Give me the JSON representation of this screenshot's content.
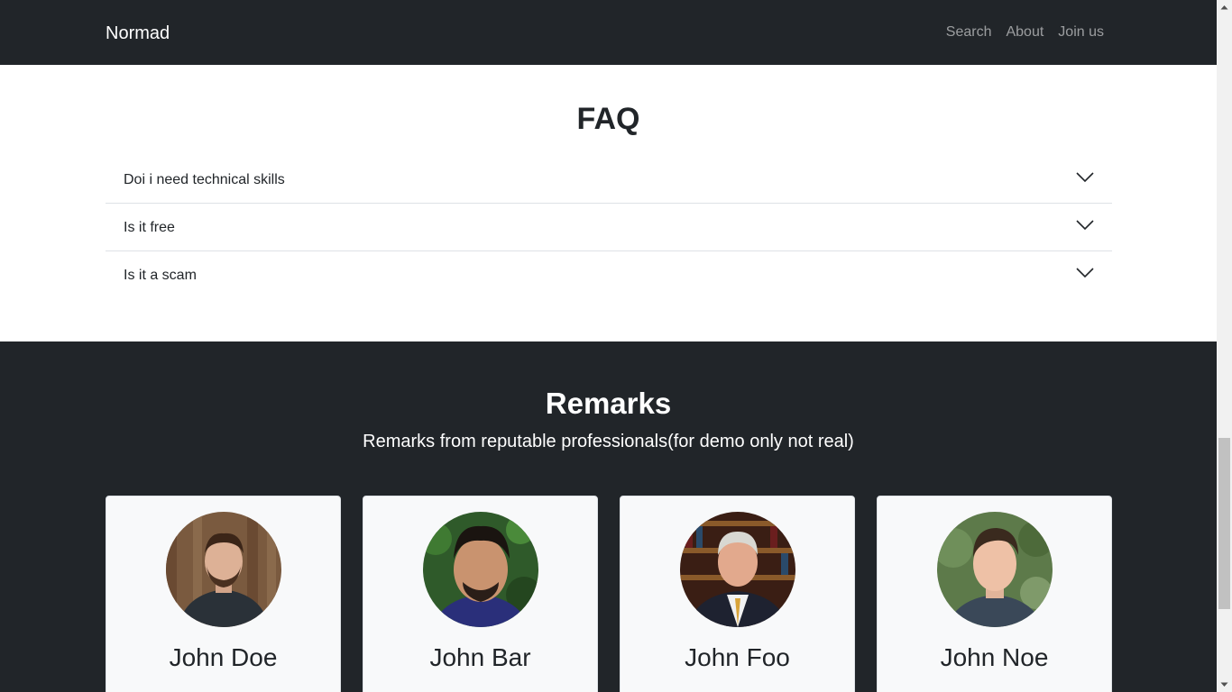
{
  "navbar": {
    "brand": "Normad",
    "links": [
      "Search",
      "About",
      "Join us"
    ]
  },
  "faq": {
    "title": "FAQ",
    "items": [
      {
        "question": "Doi i need technical skills"
      },
      {
        "question": "Is it free"
      },
      {
        "question": "Is it a scam"
      }
    ]
  },
  "remarks": {
    "title": "Remarks",
    "subtitle": "Remarks from reputable professionals(for demo only not real)",
    "cards": [
      {
        "name": "John Doe"
      },
      {
        "name": "John Bar"
      },
      {
        "name": "John Foo"
      },
      {
        "name": "John Noe"
      }
    ]
  },
  "colors": {
    "dark": "#212529",
    "card_bg": "#f8f9fa",
    "nav_link": "rgba(255,255,255,0.55)"
  },
  "icons": {
    "faq_toggle": "chevron-down-icon"
  }
}
